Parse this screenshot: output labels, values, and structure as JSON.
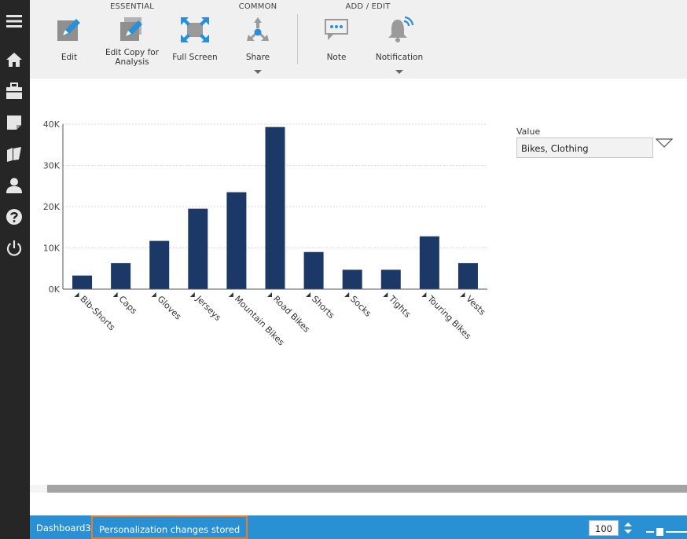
{
  "toolbar": {
    "groups": [
      "ESSENTIAL",
      "COMMON",
      "ADD / EDIT"
    ],
    "buttons": {
      "edit": "Edit",
      "edit_copy": "Edit Copy for Analysis",
      "full_screen": "Full Screen",
      "share": "Share",
      "note": "Note",
      "notification": "Notification"
    }
  },
  "nav_icons": [
    "menu-icon",
    "home-icon",
    "briefcase-icon",
    "note-icon",
    "folder-open-icon",
    "user-icon",
    "help-icon",
    "power-icon"
  ],
  "colors": {
    "bar": "#1b3866",
    "statusbar": "#2a90d4",
    "highlight": "#f07c28",
    "nav": "#262626"
  },
  "chart_data": {
    "type": "bar",
    "categories": [
      "Bib-Shorts",
      "Caps",
      "Gloves",
      "Jerseys",
      "Mountain Bikes",
      "Road Bikes",
      "Shorts",
      "Socks",
      "Tights",
      "Touring Bikes",
      "Vests"
    ],
    "values": [
      3300,
      6300,
      11700,
      19500,
      23500,
      39300,
      9000,
      4700,
      4700,
      12800,
      6300
    ],
    "ylim": [
      0,
      40000
    ],
    "yticks": [
      0,
      10000,
      20000,
      30000,
      40000
    ],
    "ytick_labels": [
      "0K",
      "10K",
      "20K",
      "30K",
      "40K"
    ],
    "grid": true
  },
  "filter": {
    "label": "Value",
    "value": "Bikes, Clothing"
  },
  "status": {
    "tab_name": "Dashboard3",
    "message": "Personalization changes stored",
    "zoom": "100"
  }
}
